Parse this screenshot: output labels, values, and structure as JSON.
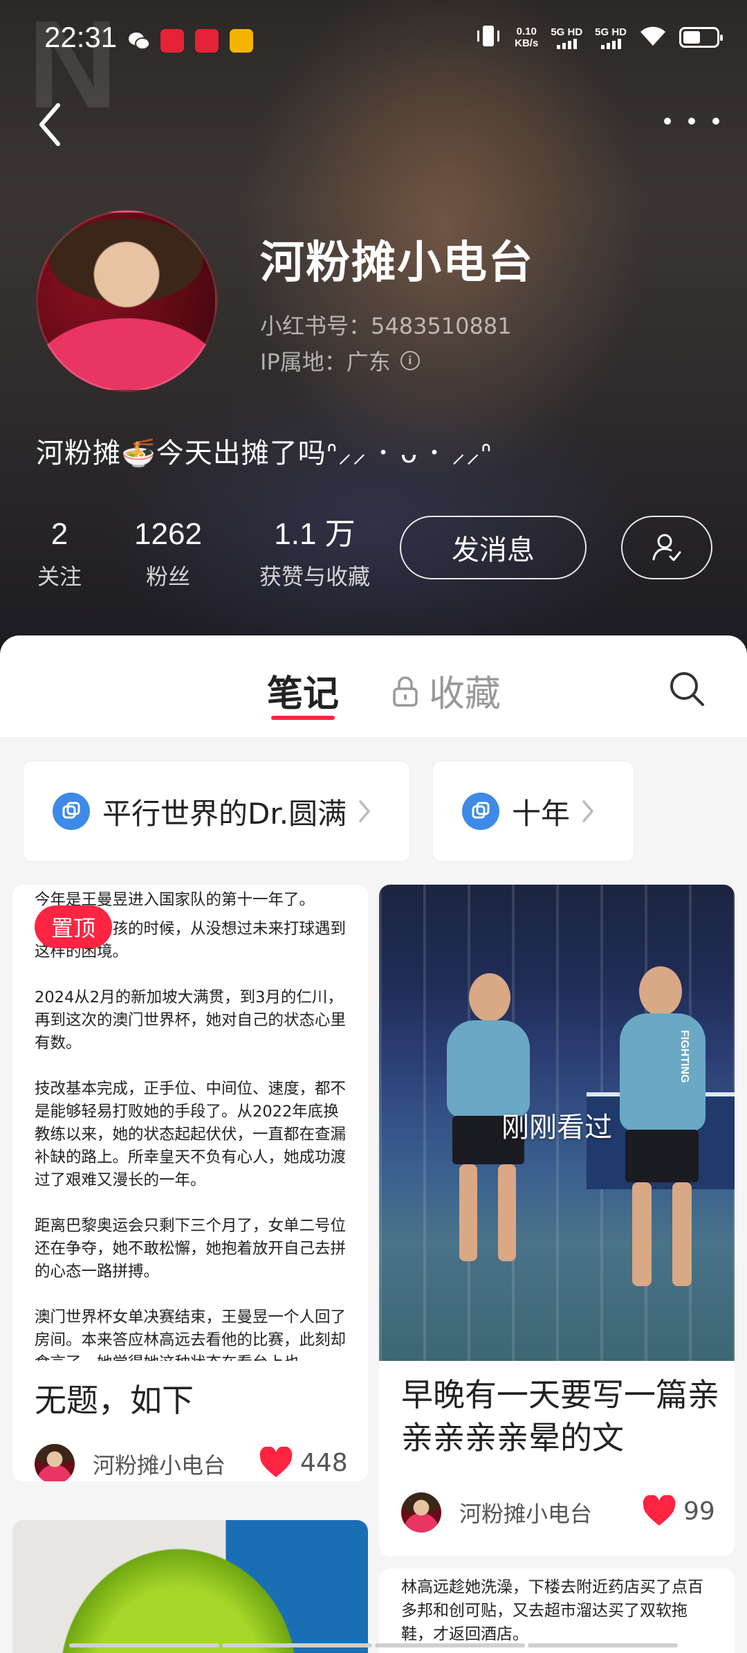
{
  "status_bar": {
    "time": "22:31",
    "net_speed": "0.10",
    "net_unit": "KB/s",
    "sim1": "5G HD",
    "sim2": "5G HD"
  },
  "profile": {
    "nickname": "河粉摊小电台",
    "red_id": "小红书号：5483510881",
    "ip_location": "IP属地：广东",
    "bio": "河粉摊🍜今天出摊了吗ᐢ⸝⸝ ･ ᴗ ･ ⸝⸝ᐢ"
  },
  "stats": [
    {
      "value": "2",
      "label": "关注"
    },
    {
      "value": "1262",
      "label": "粉丝"
    },
    {
      "value": "1.1 万",
      "label": "获赞与收藏"
    }
  ],
  "actions": {
    "message_label": "发消息"
  },
  "tabs": {
    "notes": "笔记",
    "collect": "收藏"
  },
  "collections": [
    {
      "title": "平行世界的Dr.圆满"
    },
    {
      "title": "十年"
    }
  ],
  "notes": [
    {
      "pinned_label": "置顶",
      "article_lines": [
        "今年是王曼昱进入国家队的第十一年了。",
        "小时候小女孩的时候，从没想过未来打球遇到这样的困境。",
        "2024从2月的新加坡大满贯，到3月的仁川，再到这次的澳门世界杯，她对自己的状态心里有数。",
        "技改基本完成，正手位、中间位、速度，都不是能够轻易打败她的手段了。从2022年底换教练以来，她的状态起起伏伏，一直都在查漏补缺的路上。所幸皇天不负有心人，她成功渡过了艰难又漫长的一年。",
        "距离巴黎奥运会只剩下三个月了，女单二号位还在争夺，她不敢松懈，她抱着放开自己去拼的心态一路拼搏。",
        "澳门世界杯女单决赛结束，王曼昱一个人回了房间。本来答应林高远去看他的比赛，此刻却食言了。她觉得她这种状态在看台上也"
      ],
      "title": "无题，如下",
      "author": "河粉摊小电台",
      "likes": "448"
    },
    {
      "overlay_label": "刚刚看过",
      "shirt_text": "FIGHTING",
      "title": "早晚有一天要写一篇亲亲亲亲亲晕的文",
      "author": "河粉摊小电台",
      "likes": "99"
    },
    {
      "article_text": "林高远趁她洗澡，下楼去附近药店买了点百多邦和创可贴，又去超市溜达买了双软拖鞋，才返回酒店。"
    }
  ],
  "colors": {
    "accent": "#ff2442",
    "collection_icon": "#3d8ae8"
  }
}
